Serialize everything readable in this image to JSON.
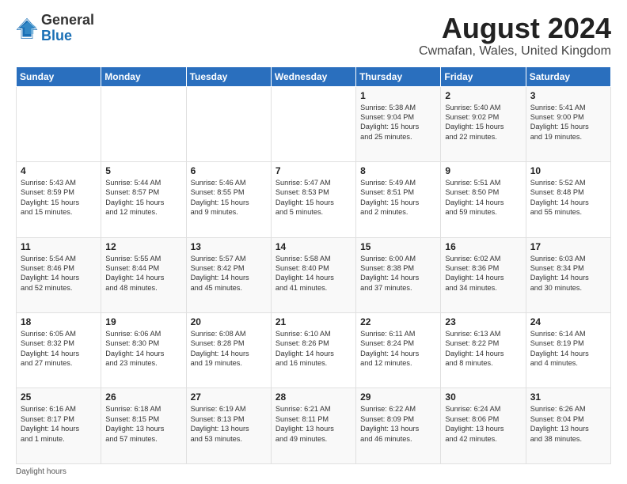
{
  "logo": {
    "general": "General",
    "blue": "Blue"
  },
  "title": "August 2024",
  "subtitle": "Cwmafan, Wales, United Kingdom",
  "days": [
    "Sunday",
    "Monday",
    "Tuesday",
    "Wednesday",
    "Thursday",
    "Friday",
    "Saturday"
  ],
  "footer": "Daylight hours",
  "weeks": [
    [
      {
        "day": "",
        "info": ""
      },
      {
        "day": "",
        "info": ""
      },
      {
        "day": "",
        "info": ""
      },
      {
        "day": "",
        "info": ""
      },
      {
        "day": "1",
        "info": "Sunrise: 5:38 AM\nSunset: 9:04 PM\nDaylight: 15 hours\nand 25 minutes."
      },
      {
        "day": "2",
        "info": "Sunrise: 5:40 AM\nSunset: 9:02 PM\nDaylight: 15 hours\nand 22 minutes."
      },
      {
        "day": "3",
        "info": "Sunrise: 5:41 AM\nSunset: 9:00 PM\nDaylight: 15 hours\nand 19 minutes."
      }
    ],
    [
      {
        "day": "4",
        "info": "Sunrise: 5:43 AM\nSunset: 8:59 PM\nDaylight: 15 hours\nand 15 minutes."
      },
      {
        "day": "5",
        "info": "Sunrise: 5:44 AM\nSunset: 8:57 PM\nDaylight: 15 hours\nand 12 minutes."
      },
      {
        "day": "6",
        "info": "Sunrise: 5:46 AM\nSunset: 8:55 PM\nDaylight: 15 hours\nand 9 minutes."
      },
      {
        "day": "7",
        "info": "Sunrise: 5:47 AM\nSunset: 8:53 PM\nDaylight: 15 hours\nand 5 minutes."
      },
      {
        "day": "8",
        "info": "Sunrise: 5:49 AM\nSunset: 8:51 PM\nDaylight: 15 hours\nand 2 minutes."
      },
      {
        "day": "9",
        "info": "Sunrise: 5:51 AM\nSunset: 8:50 PM\nDaylight: 14 hours\nand 59 minutes."
      },
      {
        "day": "10",
        "info": "Sunrise: 5:52 AM\nSunset: 8:48 PM\nDaylight: 14 hours\nand 55 minutes."
      }
    ],
    [
      {
        "day": "11",
        "info": "Sunrise: 5:54 AM\nSunset: 8:46 PM\nDaylight: 14 hours\nand 52 minutes."
      },
      {
        "day": "12",
        "info": "Sunrise: 5:55 AM\nSunset: 8:44 PM\nDaylight: 14 hours\nand 48 minutes."
      },
      {
        "day": "13",
        "info": "Sunrise: 5:57 AM\nSunset: 8:42 PM\nDaylight: 14 hours\nand 45 minutes."
      },
      {
        "day": "14",
        "info": "Sunrise: 5:58 AM\nSunset: 8:40 PM\nDaylight: 14 hours\nand 41 minutes."
      },
      {
        "day": "15",
        "info": "Sunrise: 6:00 AM\nSunset: 8:38 PM\nDaylight: 14 hours\nand 37 minutes."
      },
      {
        "day": "16",
        "info": "Sunrise: 6:02 AM\nSunset: 8:36 PM\nDaylight: 14 hours\nand 34 minutes."
      },
      {
        "day": "17",
        "info": "Sunrise: 6:03 AM\nSunset: 8:34 PM\nDaylight: 14 hours\nand 30 minutes."
      }
    ],
    [
      {
        "day": "18",
        "info": "Sunrise: 6:05 AM\nSunset: 8:32 PM\nDaylight: 14 hours\nand 27 minutes."
      },
      {
        "day": "19",
        "info": "Sunrise: 6:06 AM\nSunset: 8:30 PM\nDaylight: 14 hours\nand 23 minutes."
      },
      {
        "day": "20",
        "info": "Sunrise: 6:08 AM\nSunset: 8:28 PM\nDaylight: 14 hours\nand 19 minutes."
      },
      {
        "day": "21",
        "info": "Sunrise: 6:10 AM\nSunset: 8:26 PM\nDaylight: 14 hours\nand 16 minutes."
      },
      {
        "day": "22",
        "info": "Sunrise: 6:11 AM\nSunset: 8:24 PM\nDaylight: 14 hours\nand 12 minutes."
      },
      {
        "day": "23",
        "info": "Sunrise: 6:13 AM\nSunset: 8:22 PM\nDaylight: 14 hours\nand 8 minutes."
      },
      {
        "day": "24",
        "info": "Sunrise: 6:14 AM\nSunset: 8:19 PM\nDaylight: 14 hours\nand 4 minutes."
      }
    ],
    [
      {
        "day": "25",
        "info": "Sunrise: 6:16 AM\nSunset: 8:17 PM\nDaylight: 14 hours\nand 1 minute."
      },
      {
        "day": "26",
        "info": "Sunrise: 6:18 AM\nSunset: 8:15 PM\nDaylight: 13 hours\nand 57 minutes."
      },
      {
        "day": "27",
        "info": "Sunrise: 6:19 AM\nSunset: 8:13 PM\nDaylight: 13 hours\nand 53 minutes."
      },
      {
        "day": "28",
        "info": "Sunrise: 6:21 AM\nSunset: 8:11 PM\nDaylight: 13 hours\nand 49 minutes."
      },
      {
        "day": "29",
        "info": "Sunrise: 6:22 AM\nSunset: 8:09 PM\nDaylight: 13 hours\nand 46 minutes."
      },
      {
        "day": "30",
        "info": "Sunrise: 6:24 AM\nSunset: 8:06 PM\nDaylight: 13 hours\nand 42 minutes."
      },
      {
        "day": "31",
        "info": "Sunrise: 6:26 AM\nSunset: 8:04 PM\nDaylight: 13 hours\nand 38 minutes."
      }
    ]
  ]
}
